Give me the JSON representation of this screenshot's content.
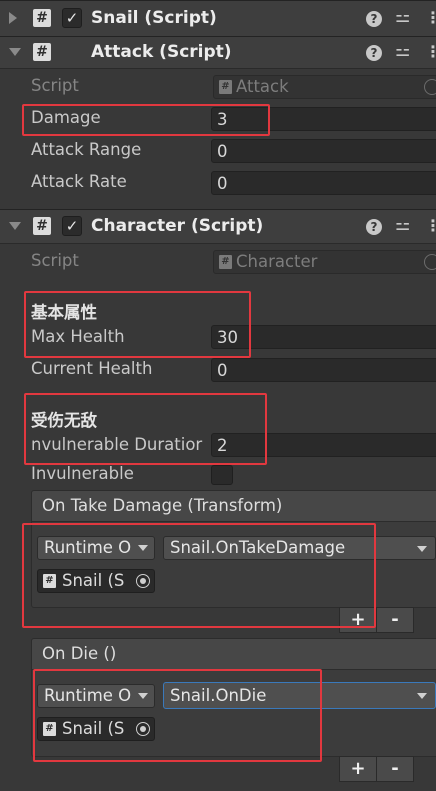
{
  "components": {
    "snail": {
      "title": "Snail (Script)"
    },
    "attack": {
      "title": "Attack (Script)",
      "script_label": "Script",
      "script_value": "Attack",
      "fields": [
        {
          "label": "Damage",
          "value": "3"
        },
        {
          "label": "Attack Range",
          "value": "0"
        },
        {
          "label": "Attack Rate",
          "value": "0"
        }
      ]
    },
    "character": {
      "title": "Character (Script)",
      "script_label": "Script",
      "script_value": "Character",
      "header_basic": "基本属性",
      "max_health_label": "Max Health",
      "max_health_value": "30",
      "current_health_label": "Current Health",
      "current_health_value": "0",
      "header_invuln": "受伤无敌",
      "invuln_duration_label": "nvulnerable Duratior",
      "invuln_duration_value": "2",
      "invulnerable_label": "Invulnerable",
      "invulnerable_checked": false
    }
  },
  "events": {
    "on_take_damage": {
      "header": "On Take Damage (Transform)",
      "runtime": "Runtime O",
      "function": "Snail.OnTakeDamage",
      "target": "Snail (S"
    },
    "on_die": {
      "header": "On Die ()",
      "runtime": "Runtime O",
      "function": "Snail.OnDie",
      "target": "Snail (S"
    }
  },
  "glyphs": {
    "hash": "#",
    "check": "✓",
    "help": "?",
    "settings": "⚍",
    "more": "⋮",
    "plus": "+",
    "minus": "-"
  },
  "colors": {
    "highlight": "#e2383f",
    "focus": "#3a79bb"
  }
}
